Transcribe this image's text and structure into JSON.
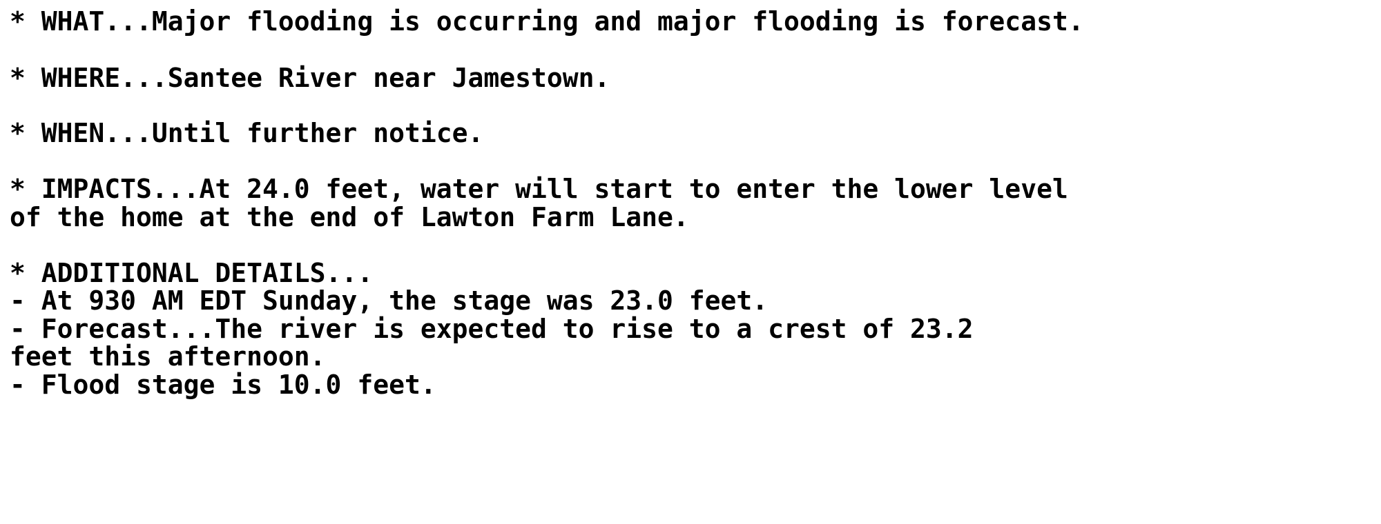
{
  "document": {
    "type": "nws-flood-warning-bulletin",
    "background_color": "#ffffff",
    "text_color": "#000000",
    "lines": [
      {
        "id": "what",
        "text": "* WHAT...Major flooding is occurring and major flooding is forecast."
      },
      {
        "id": "blank-1",
        "text": ""
      },
      {
        "id": "where",
        "text": "* WHERE...Santee River near Jamestown."
      },
      {
        "id": "blank-2",
        "text": ""
      },
      {
        "id": "when",
        "text": "* WHEN...Until further notice."
      },
      {
        "id": "blank-3",
        "text": ""
      },
      {
        "id": "impacts",
        "text": "* IMPACTS...At 24.0 feet, water will start to enter the lower level"
      },
      {
        "id": "impacts-cont",
        "text": "of the home at the end of Lawton Farm Lane."
      },
      {
        "id": "blank-4",
        "text": ""
      },
      {
        "id": "additional",
        "text": "* ADDITIONAL DETAILS..."
      },
      {
        "id": "detail-stage",
        "text": "- At 930 AM EDT Sunday, the stage was 23.0 feet."
      },
      {
        "id": "detail-forecast",
        "text": "- Forecast...The river is expected to rise to a crest of 23.2"
      },
      {
        "id": "detail-cont",
        "text": "feet this afternoon."
      },
      {
        "id": "detail-flood",
        "text": "- Flood stage is 10.0 feet."
      }
    ],
    "values": {
      "impact_stage_feet": "24.0",
      "observation_time": "930 AM EDT",
      "observation_day": "Sunday",
      "current_stage_feet": "23.0",
      "forecast_crest_feet": "23.2",
      "forecast_crest_time": "this afternoon",
      "flood_stage_feet": "10.0",
      "river": "Santee River",
      "location": "Jamestown",
      "impact_location": "Lawton Farm Lane",
      "duration": "Until further notice",
      "severity": "Major flooding"
    }
  }
}
